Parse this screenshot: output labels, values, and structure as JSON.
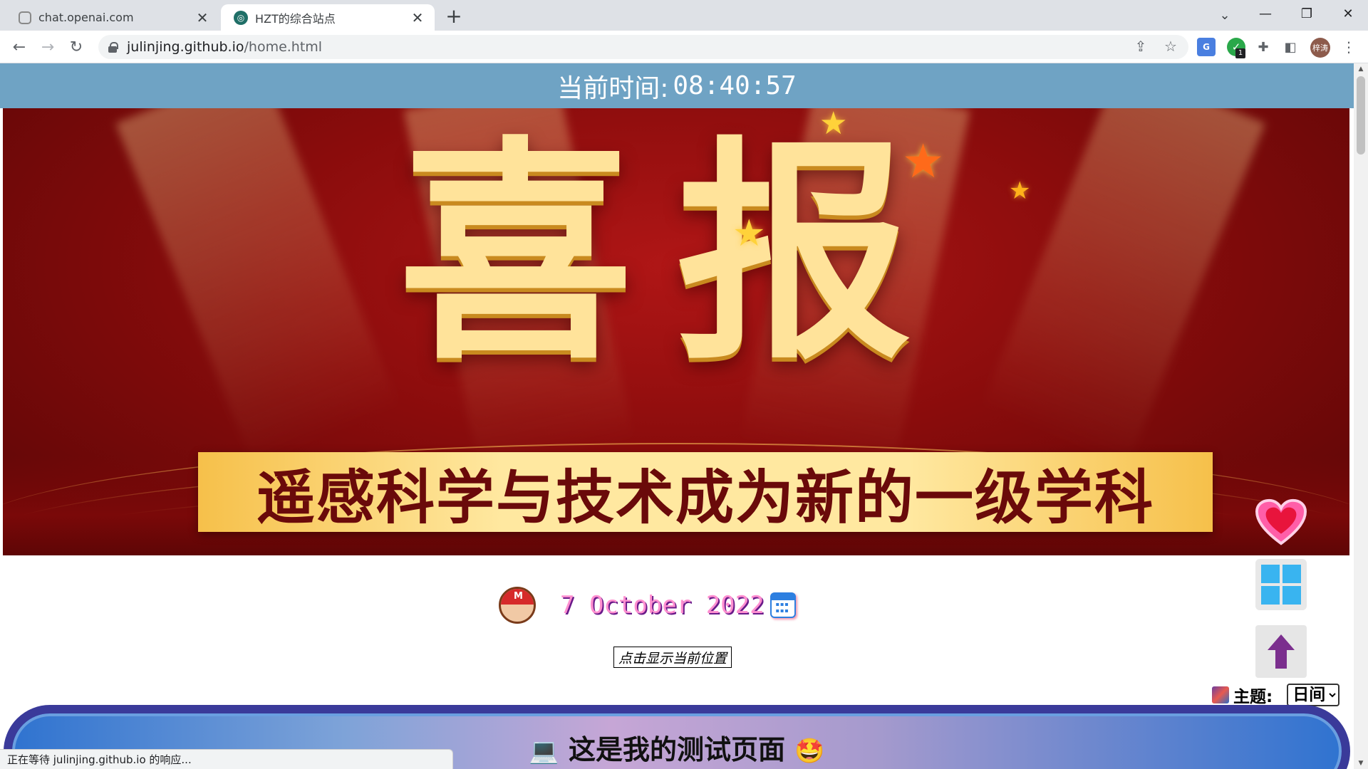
{
  "browser": {
    "tabs": [
      {
        "title": "chat.openai.com",
        "active": false,
        "favicon": "openai-icon"
      },
      {
        "title": "HZT的综合站点",
        "active": true,
        "favicon": "globe-icon"
      }
    ],
    "new_tab_symbol": "+",
    "url_host": "julinjing.github.io",
    "url_path": "/home.html",
    "avatar_text": "梓涛",
    "extension_badge": "1",
    "status_text": "正在等待 julinjing.github.io 的响应..."
  },
  "page": {
    "time_label": "当前时间:",
    "time_value": "08:40:57",
    "banner": {
      "headline": "喜报",
      "subtitle": "遥感科学与技术成为新的一级学科"
    },
    "date_text": "7 October 2022",
    "location_button": "点击显示当前位置",
    "theme_label": "主题:",
    "theme_selected": "日间",
    "test_title": "这是我的测试页面"
  },
  "colors": {
    "timebar": "#6fa3c4",
    "banner_red": "#b01616",
    "ribbon_gold": "#f6c04a",
    "date_pink": "#ff8fd0"
  }
}
